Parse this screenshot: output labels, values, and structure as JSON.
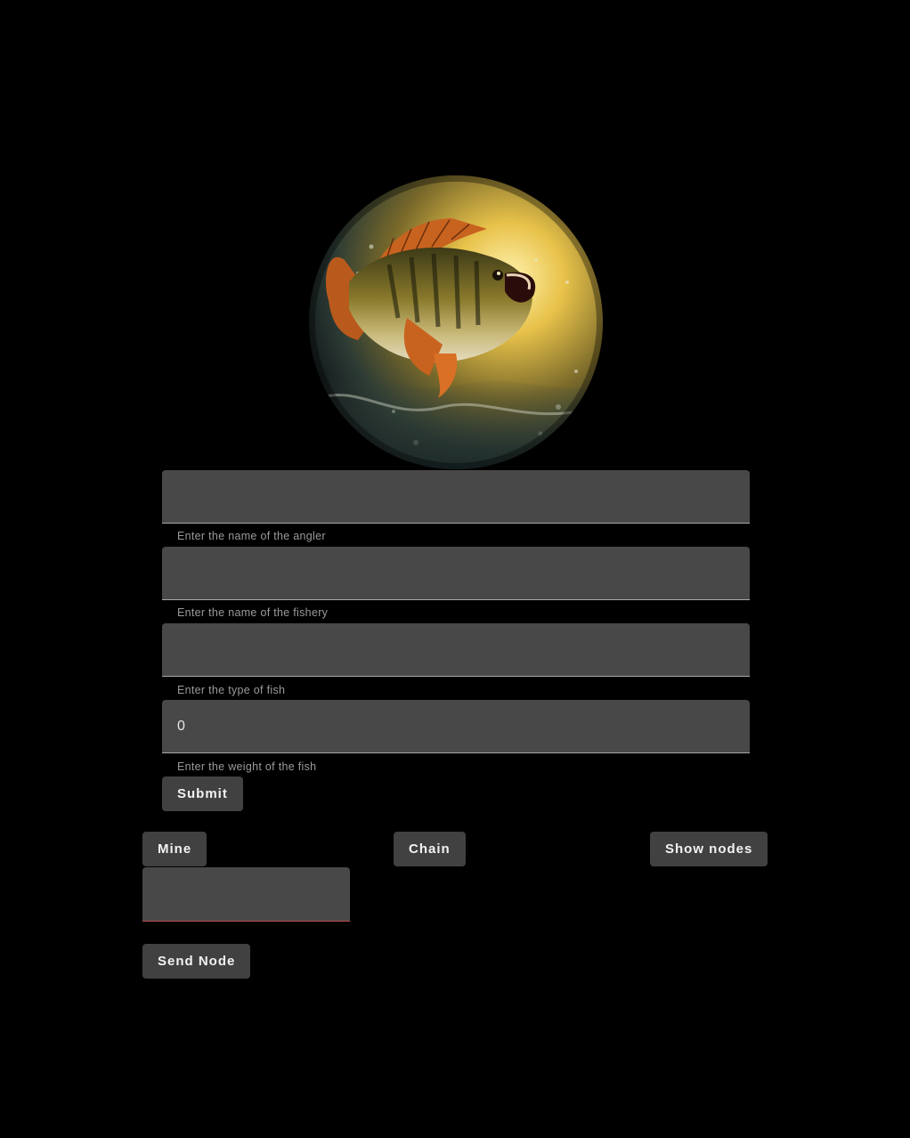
{
  "logo": {
    "icon": "leaping-bass-fish-image",
    "colors": {
      "glow": "#e8c24a",
      "water": "#2c3b34",
      "fish_body": "#8a7a2c",
      "fins": "#c8631f"
    }
  },
  "form": {
    "angler": {
      "value": "",
      "helper": "Enter the name of the angler"
    },
    "fishery": {
      "value": "",
      "helper": "Enter the name of the fishery"
    },
    "fish_type": {
      "value": "",
      "helper": "Enter the type of fish"
    },
    "weight": {
      "value": "0",
      "helper": "Enter the weight of the fish"
    },
    "submit_label": "Submit"
  },
  "actions": {
    "mine_label": "Mine",
    "chain_label": "Chain",
    "show_nodes_label": "Show nodes"
  },
  "node": {
    "value": "",
    "send_label": "Send Node"
  },
  "colors": {
    "background": "#000000",
    "field_bg": "#484848",
    "button_bg": "#414141",
    "helper_text": "#9a9a9a",
    "error_underline": "#b84a4a"
  }
}
